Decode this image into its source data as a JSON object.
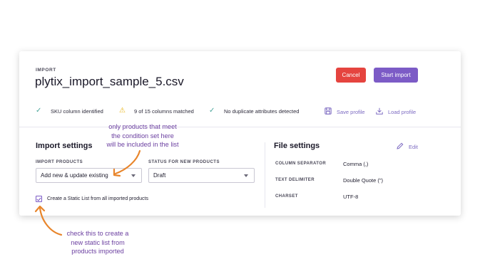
{
  "header": {
    "eyebrow": "IMPORT",
    "filename": "plytix_import_sample_5.csv",
    "cancel_label": "Cancel",
    "start_label": "Start import"
  },
  "status": {
    "sku": "SKU column identified",
    "columns": "9 of 15 columns matched",
    "duplicates": "No duplicate attributes detected",
    "save_profile": "Save profile",
    "load_profile": "Load profile"
  },
  "import_settings": {
    "title": "Import settings",
    "import_products_label": "IMPORT PRODUCTS",
    "import_products_value": "Add new & update existing",
    "status_label": "STATUS FOR NEW PRODUCTS",
    "status_value": "Draft",
    "static_list_label": "Create a Static List from all imported products",
    "static_list_checked": true
  },
  "file_settings": {
    "title": "File settings",
    "edit_label": "Edit",
    "rows": [
      {
        "key": "COLUMN SEPARATOR",
        "value": "Comma (,)"
      },
      {
        "key": "TEXT DELIMITER",
        "value": "Double Quote (\")"
      },
      {
        "key": "CHARSET",
        "value": "UTF-8"
      }
    ]
  },
  "annotations": {
    "top": [
      "only products that meet",
      "the condition set here",
      "will be included in the list"
    ],
    "bottom": [
      "check this to create a",
      "new static list from",
      "products imported"
    ]
  },
  "colors": {
    "cancel": "#e5443f",
    "primary": "#7c5bc6",
    "check": "#48a59a",
    "warning": "#e9b518",
    "arrow": "#e8852b",
    "annotation_text": "#6b3fa0"
  }
}
